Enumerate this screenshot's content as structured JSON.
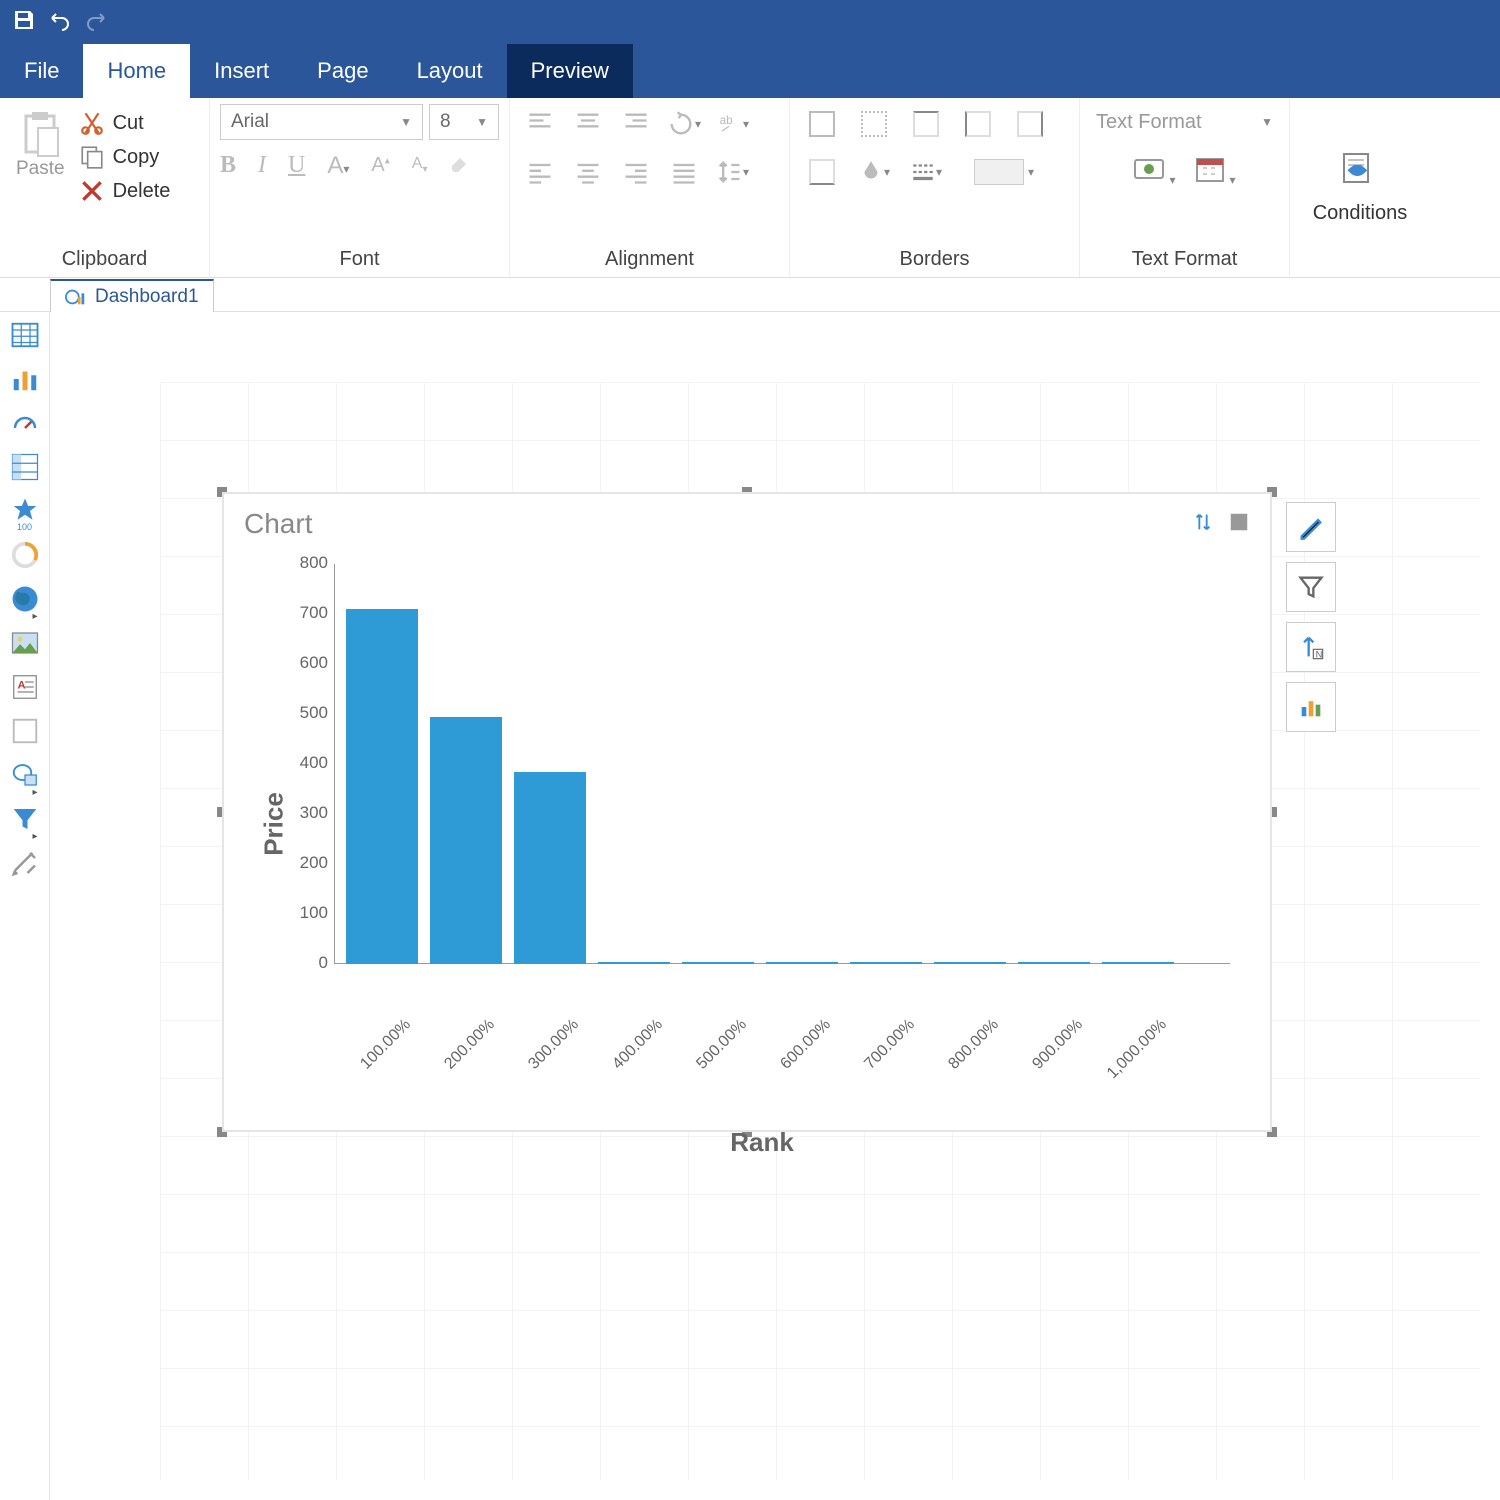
{
  "titlebar": {
    "save": "save-icon",
    "undo": "undo-icon",
    "redo": "redo-icon"
  },
  "menu": {
    "items": [
      "File",
      "Home",
      "Insert",
      "Page",
      "Layout",
      "Preview"
    ],
    "active": "Home"
  },
  "ribbon": {
    "clipboard": {
      "label": "Clipboard",
      "paste": "Paste",
      "cut": "Cut",
      "copy": "Copy",
      "delete": "Delete"
    },
    "font": {
      "label": "Font",
      "name": "Arial",
      "size": "8"
    },
    "alignment": {
      "label": "Alignment"
    },
    "borders": {
      "label": "Borders"
    },
    "textformat": {
      "label": "Text Format",
      "select": "Text Format"
    },
    "conditions": {
      "label": "Conditions"
    }
  },
  "tab": {
    "name": "Dashboard1"
  },
  "chart": {
    "title": "Chart",
    "ylabel": "Price",
    "xlabel": "Rank"
  },
  "chart_data": {
    "type": "bar",
    "title": "Chart",
    "xlabel": "Rank",
    "ylabel": "Price",
    "categories": [
      "100.00%",
      "200.00%",
      "300.00%",
      "400.00%",
      "500.00%",
      "600.00%",
      "700.00%",
      "800.00%",
      "900.00%",
      "1,000.00%"
    ],
    "values": [
      710,
      495,
      385,
      5,
      5,
      5,
      5,
      5,
      5,
      5
    ],
    "yticks": [
      0,
      100,
      200,
      300,
      400,
      500,
      600,
      700,
      800
    ],
    "ylim": [
      0,
      800
    ]
  },
  "side_tools": [
    "table",
    "bar-chart",
    "gauge",
    "pivot",
    "star-100",
    "progress-ring",
    "globe",
    "image",
    "rich-text",
    "panel",
    "shape",
    "filter",
    "settings"
  ]
}
